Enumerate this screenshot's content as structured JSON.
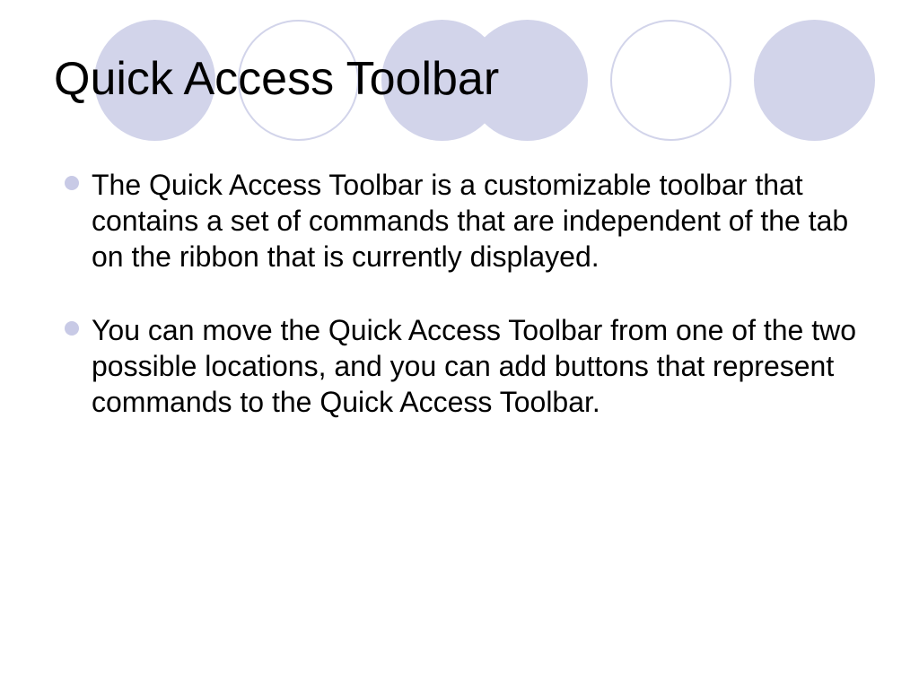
{
  "title": "Quick Access Toolbar",
  "bullets": [
    "The Quick Access Toolbar is a customizable toolbar that contains a set of commands that are independent of the tab on the ribbon that is currently displayed.",
    "You can move the Quick Access Toolbar from one of the two possible locations, and you can add buttons that represent commands to the Quick Access Toolbar."
  ],
  "colors": {
    "accent": "#d2d4ea",
    "bullet": "#c8cae6"
  }
}
